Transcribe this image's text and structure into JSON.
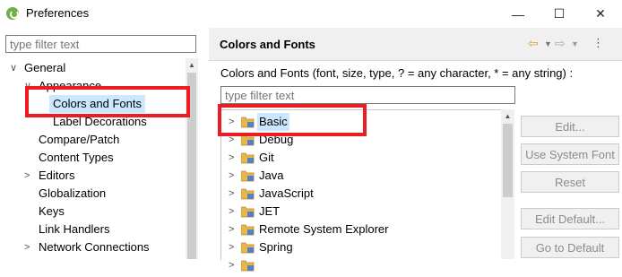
{
  "window": {
    "title": "Preferences",
    "minimize": "—",
    "maximize": "☐",
    "close": "✕"
  },
  "left": {
    "filter_placeholder": "type filter text",
    "tree": [
      {
        "label": "General",
        "indent": 0,
        "chevron": "∨"
      },
      {
        "label": "Appearance",
        "indent": 1,
        "chevron": "∨"
      },
      {
        "label": "Colors and Fonts",
        "indent": 2,
        "chevron": ""
      },
      {
        "label": "Label Decorations",
        "indent": 2,
        "chevron": ""
      },
      {
        "label": "Compare/Patch",
        "indent": 1,
        "chevron": ""
      },
      {
        "label": "Content Types",
        "indent": 1,
        "chevron": ""
      },
      {
        "label": "Editors",
        "indent": 1,
        "chevron": ">"
      },
      {
        "label": "Globalization",
        "indent": 1,
        "chevron": ""
      },
      {
        "label": "Keys",
        "indent": 1,
        "chevron": ""
      },
      {
        "label": "Link Handlers",
        "indent": 1,
        "chevron": ""
      },
      {
        "label": "Network Connections",
        "indent": 1,
        "chevron": ">"
      }
    ]
  },
  "right": {
    "title": "Colors and Fonts",
    "description": "Colors and Fonts (font, size, type, ? = any character, * = any string) :",
    "filter_placeholder": "type filter text",
    "tree": [
      "Basic",
      "Debug",
      "Git",
      "Java",
      "JavaScript",
      "JET",
      "Remote System Explorer",
      "Spring",
      ""
    ],
    "buttons": {
      "edit": "Edit...",
      "use_system_font": "Use System Font",
      "reset": "Reset",
      "edit_default": "Edit Default...",
      "go_to_default": "Go to Default"
    }
  },
  "colors": {
    "highlight": "#ec1c24",
    "selection": "#cce8ff",
    "folder": "#e8b84a"
  }
}
